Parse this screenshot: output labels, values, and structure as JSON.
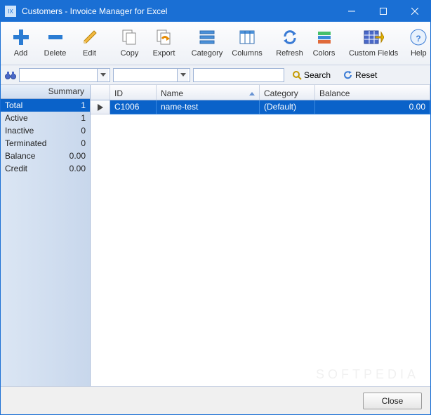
{
  "window": {
    "title": "Customers - Invoice Manager for Excel"
  },
  "toolbar": {
    "add": "Add",
    "delete": "Delete",
    "edit": "Edit",
    "copy": "Copy",
    "export": "Export",
    "category": "Category",
    "columns": "Columns",
    "refresh": "Refresh",
    "colors": "Colors",
    "custom_fields": "Custom Fields",
    "help": "Help"
  },
  "filter": {
    "search_label": "Search",
    "reset_label": "Reset",
    "combo1_value": "",
    "combo2_value": "",
    "search_value": ""
  },
  "sidebar": {
    "header": "Summary",
    "rows": [
      {
        "key": "Total",
        "value": "1",
        "selected": true
      },
      {
        "key": "Active",
        "value": "1"
      },
      {
        "key": "Inactive",
        "value": "0"
      },
      {
        "key": "Terminated",
        "value": "0"
      },
      {
        "key": "Balance",
        "value": "0.00"
      },
      {
        "key": "Credit",
        "value": "0.00"
      }
    ]
  },
  "grid": {
    "columns": [
      "ID",
      "Name",
      "Category",
      "Balance"
    ],
    "sort_column": "Name",
    "rows": [
      {
        "id": "C1006",
        "name": "name-test",
        "category": "(Default)",
        "balance": "0.00",
        "selected": true
      }
    ]
  },
  "footer": {
    "close": "Close"
  },
  "watermark": "SOFTPEDIA"
}
